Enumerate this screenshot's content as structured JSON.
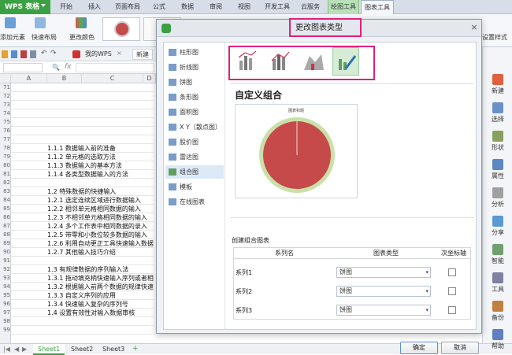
{
  "app": {
    "title": "WPS 表格"
  },
  "ribbon_tabs": [
    {
      "label": "开始"
    },
    {
      "label": "插入"
    },
    {
      "label": "页面布局"
    },
    {
      "label": "公式"
    },
    {
      "label": "数据"
    },
    {
      "label": "审阅"
    },
    {
      "label": "视图"
    },
    {
      "label": "开发工具"
    },
    {
      "label": "云服务"
    },
    {
      "label": "绘图工具"
    },
    {
      "label": "图表工具"
    }
  ],
  "ribbon": {
    "add_element": "添加元素",
    "quick_layout": "快速布局",
    "change_color": "更改颜色",
    "set_style": "设置样式"
  },
  "toolbar": {
    "my_wps": "我的WPS",
    "new_tab": "新建"
  },
  "formula": {
    "fx": "fx"
  },
  "sheet": {
    "columns": [
      "A",
      "B",
      "C",
      "D"
    ],
    "rows": [
      {
        "num": "71",
        "text": ""
      },
      {
        "num": "72",
        "text": ""
      },
      {
        "num": "73",
        "text": ""
      },
      {
        "num": "74",
        "text": ""
      },
      {
        "num": "75",
        "text": ""
      },
      {
        "num": "76",
        "text": ""
      },
      {
        "num": "77",
        "text": ""
      },
      {
        "num": "78",
        "text": "1.1.1 数据输入前的准备"
      },
      {
        "num": "79",
        "text": "1.1.2 单元格的选取方法"
      },
      {
        "num": "80",
        "text": "1.1.3 数据输入的基本方法"
      },
      {
        "num": "81",
        "text": "1.1.4 各类型数据输入的方法"
      },
      {
        "num": "82",
        "text": ""
      },
      {
        "num": "83",
        "text": "1.2 特殊数据的快捷输入"
      },
      {
        "num": "84",
        "text": "1.2.1 选定连续区域进行数据输入"
      },
      {
        "num": "85",
        "text": "1.2.2 相邻单元格相同数据的输入"
      },
      {
        "num": "86",
        "text": "1.2.3 不相邻单元格相同数据的输入"
      },
      {
        "num": "87",
        "text": "1.2.4 多个工作表中相同数据的录入"
      },
      {
        "num": "88",
        "text": "1.2.5 带零和小数位较多数据的输入"
      },
      {
        "num": "89",
        "text": "1.2.6 利用自动更正工具快速输入数据"
      },
      {
        "num": "90",
        "text": "1.2.7 其他输入技巧介绍"
      },
      {
        "num": "91",
        "text": ""
      },
      {
        "num": "92",
        "text": "1.3 有规律数据的序列输入法"
      },
      {
        "num": "93",
        "text": "1.3.1 拖动填充柄快速输入序列或者相"
      },
      {
        "num": "94",
        "text": "1.3.2 根据输入前两个数据的规律快速"
      },
      {
        "num": "95",
        "text": "1.3.3 自定义序列的应用"
      },
      {
        "num": "96",
        "text": "1.3.4 快速输入复杂的序列号"
      },
      {
        "num": "97",
        "text": "1.4 设置有效性对输入数据审核"
      },
      {
        "num": "98",
        "text": ""
      },
      {
        "num": "99",
        "text": ""
      }
    ]
  },
  "sheet_tabs": [
    "Sheet1",
    "Sheet2",
    "Sheet3"
  ],
  "right_panel": [
    {
      "label": "新建",
      "icon": "new-icon"
    },
    {
      "label": "选择",
      "icon": "select-icon"
    },
    {
      "label": "形状",
      "icon": "shape-icon"
    },
    {
      "label": "属性",
      "icon": "property-icon"
    },
    {
      "label": "分析",
      "icon": "analysis-icon"
    },
    {
      "label": "分享",
      "icon": "share-icon"
    },
    {
      "label": "智能",
      "icon": "smart-icon"
    },
    {
      "label": "工具",
      "icon": "tool-icon"
    },
    {
      "label": "备份",
      "icon": "backup-icon"
    },
    {
      "label": "帮助",
      "icon": "help-icon"
    }
  ],
  "dialog": {
    "title": "更改图表类型",
    "chart_types": [
      {
        "label": "柱形图"
      },
      {
        "label": "折线图"
      },
      {
        "label": "饼图"
      },
      {
        "label": "条形图"
      },
      {
        "label": "面积图"
      },
      {
        "label": "X Y（散点图）"
      },
      {
        "label": "股价图"
      },
      {
        "label": "雷达图"
      },
      {
        "label": "组合图"
      },
      {
        "label": "模板"
      },
      {
        "label": "在线图表"
      }
    ],
    "selected_type": "组合图",
    "custom_title": "自定义组合",
    "preview_chart_title": "图表标题",
    "create_combo_label": "创建组合图表",
    "series_headers": {
      "name": "系列名",
      "type": "图表类型",
      "secondary": "次坐标轴"
    },
    "series": [
      {
        "name": "系列1",
        "type": "饼图"
      },
      {
        "name": "系列2",
        "type": "饼图"
      },
      {
        "name": "系列3",
        "type": "饼图"
      }
    ],
    "ok": "确定",
    "cancel": "取消"
  },
  "colors": {
    "accent": "#3aa043",
    "highlight": "#e0207a",
    "pie_fill": "#c64a4a",
    "pie_ring": "#c9e0a8"
  }
}
